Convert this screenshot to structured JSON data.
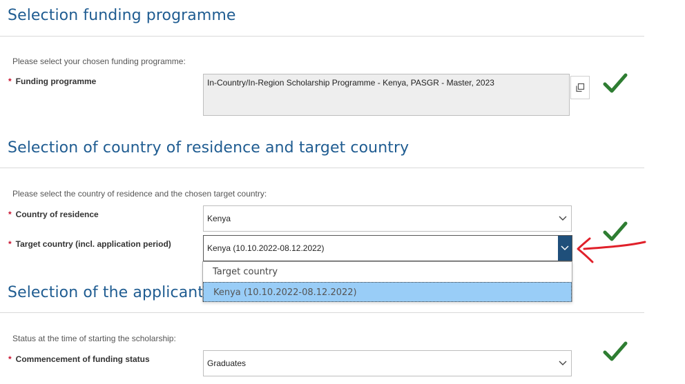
{
  "sections": {
    "funding": {
      "title": "Selection funding programme",
      "intro": "Please select your chosen funding programme:",
      "field_label": "Funding programme",
      "field_value": "In-Country/In-Region Scholarship Programme - Kenya, PASGR - Master, 2023"
    },
    "country": {
      "title": "Selection of country of residence and target country",
      "intro": "Please select the country of residence and the chosen target country:",
      "residence_label": "Country of residence",
      "residence_value": "Kenya",
      "target_label": "Target country (incl. application period)",
      "target_value": "Kenya (10.10.2022-08.12.2022)"
    },
    "status": {
      "title": "Selection of the applicant s",
      "intro": "Status at the time of starting the scholarship:",
      "field_label": "Commencement of funding status",
      "field_value": "Graduates"
    }
  },
  "required_marker": "*",
  "dropdown": {
    "placeholder": "Target country",
    "options": [
      "Kenya (10.10.2022-08.12.2022)"
    ]
  },
  "colors": {
    "heading": "#1f5c91",
    "required": "#c8102e",
    "check": "#2e7d32",
    "arrow": "#e0202a",
    "select_active": "#1f4f7a",
    "option_highlight": "#99cdf7"
  },
  "icons": {
    "check": "check-icon",
    "open_window": "open-window-icon",
    "chevron": "chevron-down-icon",
    "annotation_arrow": "red-arrow-annotation"
  }
}
